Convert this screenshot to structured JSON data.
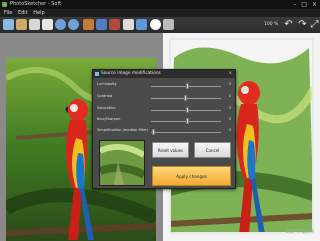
{
  "window": {
    "title": "PhotoSketcher - Soft",
    "min_glyph": "–",
    "max_glyph": "□",
    "close_glyph": "×"
  },
  "menu": [
    {
      "label": "File"
    },
    {
      "label": "Edit"
    },
    {
      "label": "Help"
    }
  ],
  "toolbar": {
    "zoom": "100 %"
  },
  "dialog": {
    "title": "Source image modifications",
    "close_glyph": "×",
    "sliders": [
      {
        "label": "Luminosity",
        "value": "0",
        "level": 0.5
      },
      {
        "label": "Contrast",
        "value": "0",
        "level": 0.48
      },
      {
        "label": "Saturation",
        "value": "0",
        "level": 0.5
      },
      {
        "label": "Blur/Sharpen",
        "value": "0",
        "level": 0.5
      },
      {
        "label": "Simplification (median filter)",
        "value": "0",
        "level": 0.02
      }
    ],
    "reset_label": "Reset values",
    "cancel_label": "Cancel",
    "apply_label": "Apply changes"
  },
  "watermark": "SOFTPEDIA",
  "colors": {
    "accent": "#f2aa30",
    "dialog_bg": "#4a4a4a"
  }
}
